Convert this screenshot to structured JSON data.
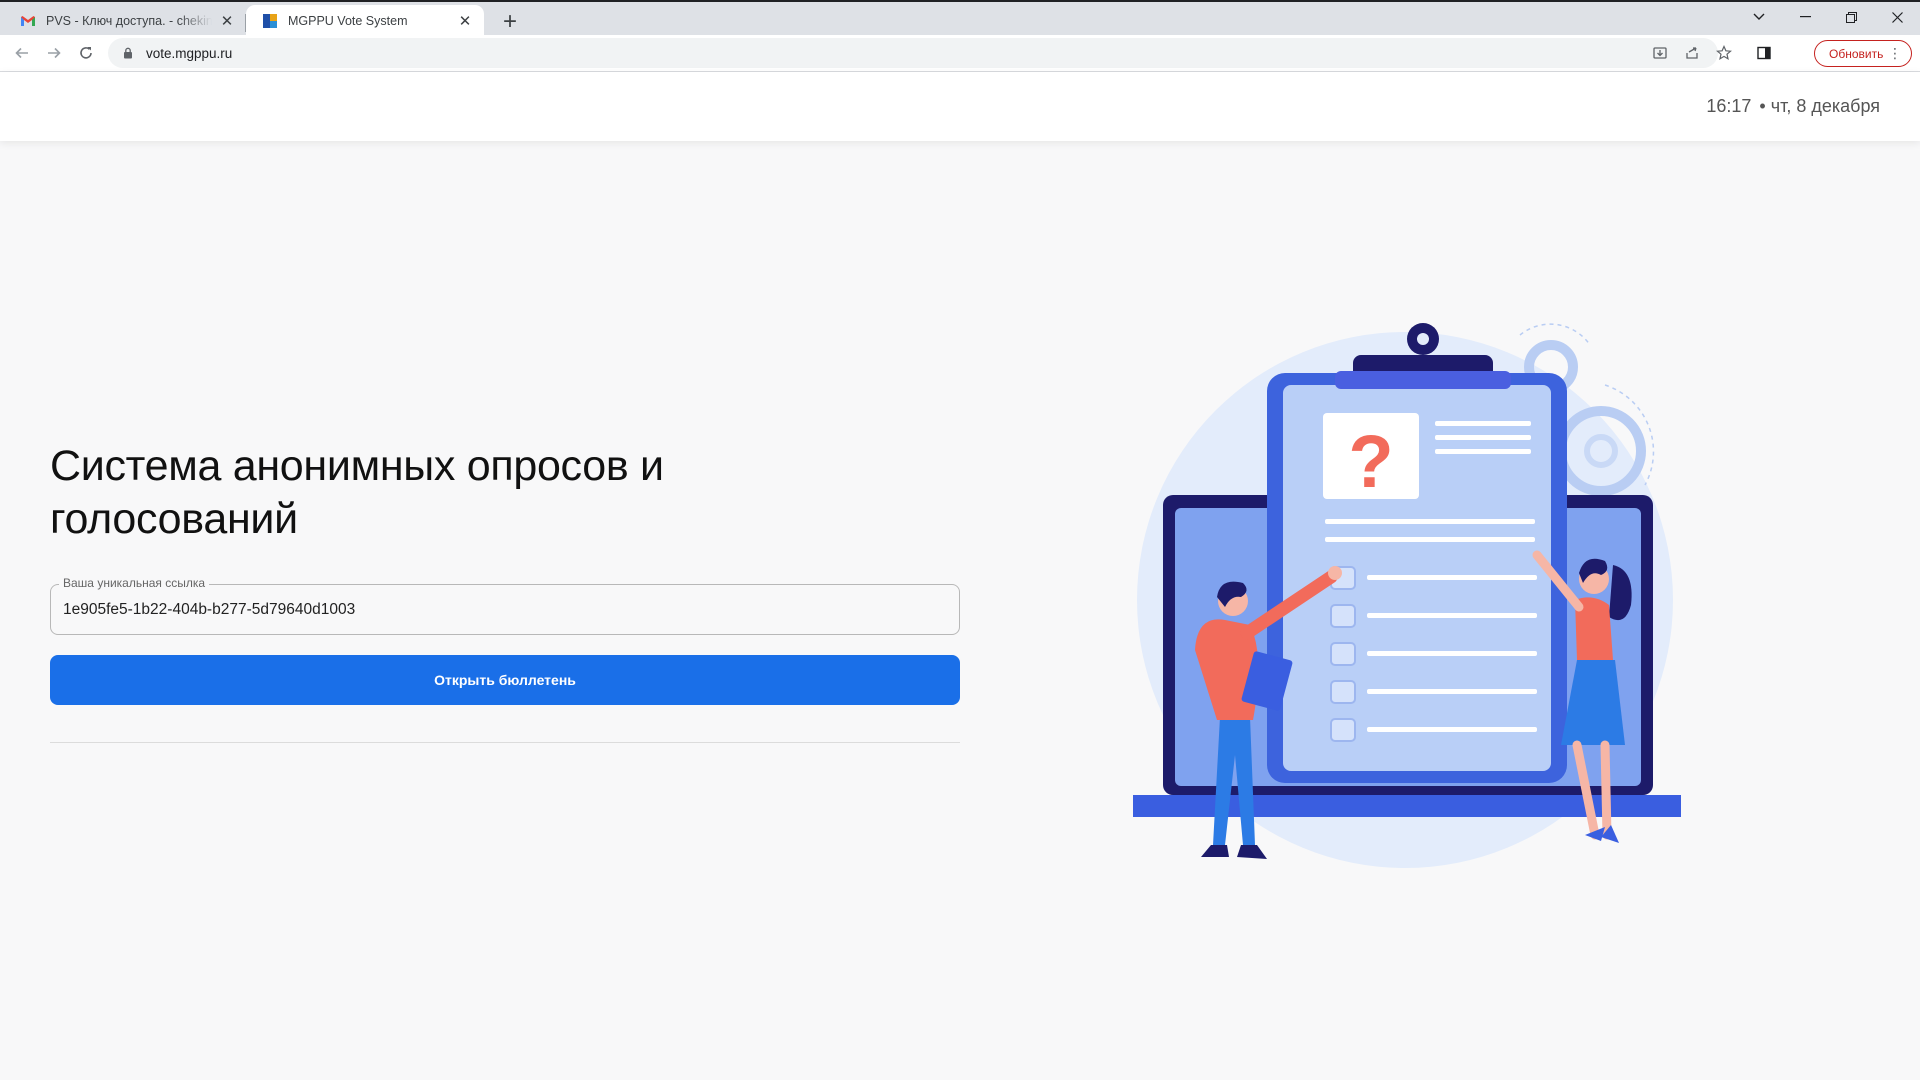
{
  "browser": {
    "tabs": [
      {
        "title": "PVS - Ключ доступа. - chekinivan",
        "favicon": "gmail-icon",
        "active": false
      },
      {
        "title": "MGPPU Vote System",
        "favicon": "mgppu-icon",
        "active": true
      }
    ],
    "address": "vote.mgppu.ru",
    "update_label": "Обновить"
  },
  "header": {
    "time": "16:17",
    "date": "• чт, 8 декабря"
  },
  "main": {
    "title_line1": "Система анонимных опросов и",
    "title_line2": "голосований",
    "link_field": {
      "label": "Ваша уникальная ссылка",
      "value": "1e905fe5-1b22-404b-b277-5d79640d1003"
    },
    "open_button": "Открыть бюллетень"
  },
  "illustration": {
    "question_mark": "?"
  },
  "colors": {
    "primary": "#1a6fe8",
    "clipboard": "#3d63dd",
    "accent": "#f26b5b",
    "dark": "#1a1a5e"
  }
}
